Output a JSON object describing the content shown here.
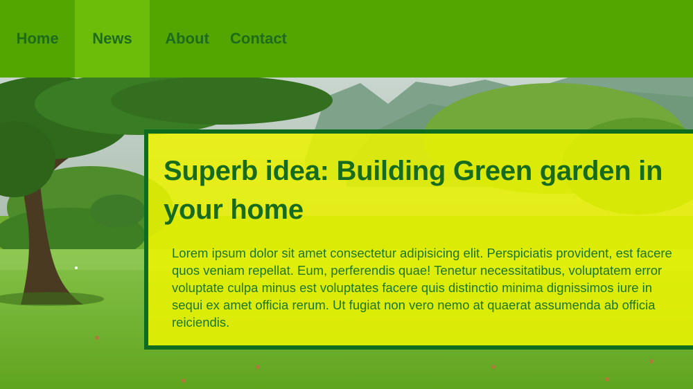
{
  "nav": {
    "items": [
      {
        "label": "Home"
      },
      {
        "label": "News"
      },
      {
        "label": "About"
      },
      {
        "label": "Contact"
      }
    ],
    "active": "News",
    "colors": {
      "bar": "#53a600",
      "active": "#6cbd0a",
      "text": "#1e6b1a"
    }
  },
  "hero": {
    "title": "Superb idea: Building Green garden in your home",
    "body": "Lorem ipsum dolor sit amet consectetur adipisicing elit. Perspiciatis provident, est facere quos veniam repellat. Eum, perferendis quae! Tenetur necessitatibus, voluptatem error voluptate culpa minus est voluptates facere quis distinctio minima dignissimos iure in sequi ex amet officia rerum. Ut fugiat non vero nemo at quaerat assumenda ab officia reiciendis.",
    "colors": {
      "card_background": "#ecf400",
      "card_border": "#0f6b20",
      "title": "#176b1d"
    }
  }
}
